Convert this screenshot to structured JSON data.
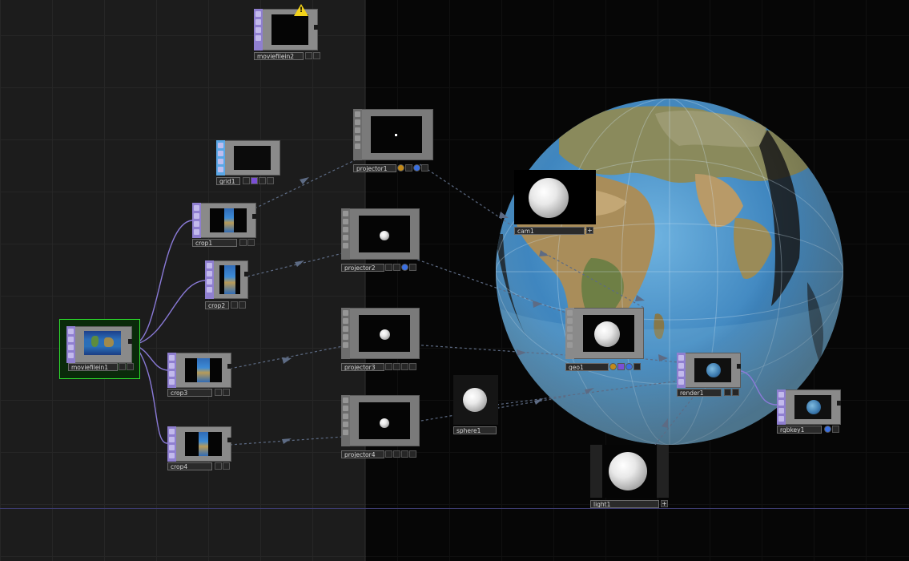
{
  "app": {
    "accent": "#8f7fd0",
    "wire_color": "#5d6b84",
    "link_color": "#8a7ad8",
    "selection_color": "#2ee12e"
  },
  "nodes": {
    "moviefilein2": "moviefilein2",
    "grid1": "grid1",
    "crop1": "crop1",
    "crop2": "crop2",
    "crop3": "crop3",
    "crop4": "crop4",
    "moviefilein1": "moviefilein1",
    "projector1": "projector1",
    "projector2": "projector2",
    "projector3": "projector3",
    "projector4": "projector4",
    "cam1": "cam1",
    "geo1": "geo1",
    "sphere1": "sphere1",
    "render1": "render1",
    "rgbkey1": "rgbkey1",
    "light1": "light1"
  },
  "icons": {
    "warning": "warning-icon",
    "viewer_toggle": "plus-icon"
  }
}
